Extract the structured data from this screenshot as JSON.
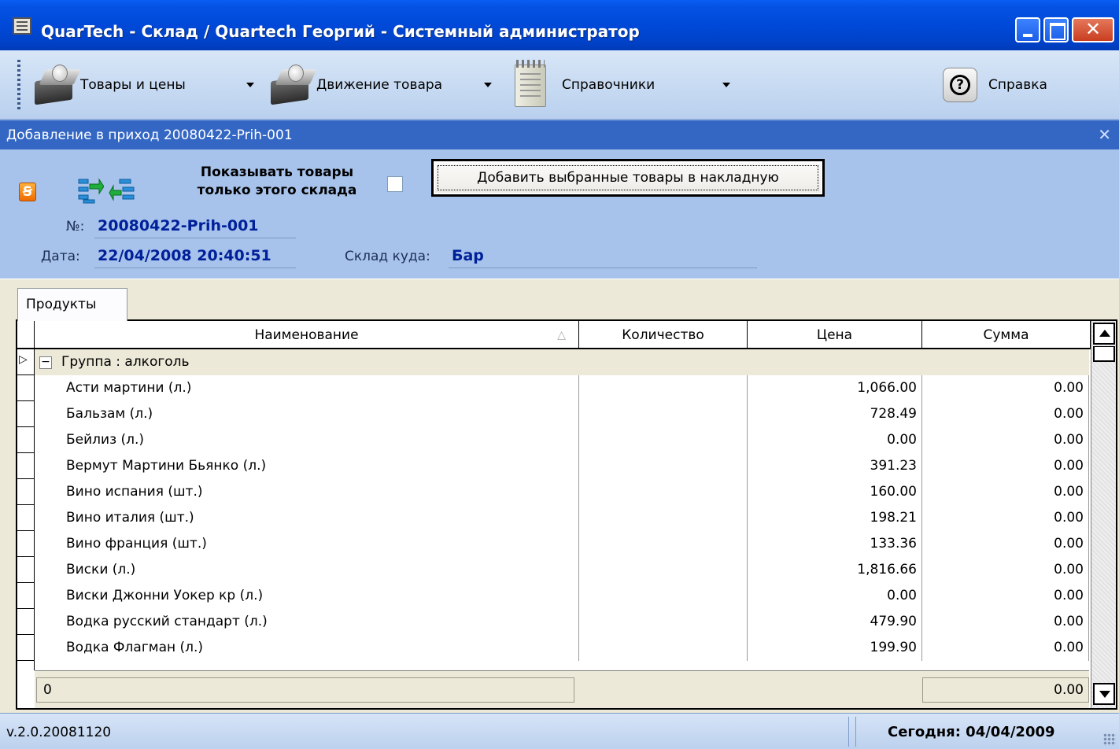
{
  "window": {
    "title": "QuarTech - Склад / Quartech Георгий - Системный администратор"
  },
  "toolbar": {
    "items": [
      {
        "label": "Товары и цены",
        "icon": "box-icon"
      },
      {
        "label": "Движение товара",
        "icon": "box-icon"
      },
      {
        "label": "Справочники",
        "icon": "notebook-icon"
      },
      {
        "label": "Справка",
        "icon": "help-icon"
      }
    ]
  },
  "document": {
    "title": "Добавление в приход 20080422-Prih-001",
    "show_only_label_1": "Показывать товары",
    "show_only_label_2": "только этого склада",
    "show_only_checked": false,
    "add_button_label": "Добавить выбранные товары в накладную",
    "number_label": "№:",
    "number_value": "20080422-Prih-001",
    "date_label": "Дата:",
    "date_value": "22/04/2008 20:40:51",
    "warehouse_label": "Склад куда:",
    "warehouse_value": "Бар"
  },
  "tabs": [
    {
      "label": "Продукты"
    }
  ],
  "grid": {
    "columns": [
      "Наименование",
      "Количество",
      "Цена",
      "Сумма"
    ],
    "group_label": "Группа : алкоголь",
    "group_expander": "−",
    "rows": [
      {
        "name": "Асти мартини (л.)",
        "qty": "",
        "price": "1,066.00",
        "sum": "0.00"
      },
      {
        "name": "Бальзам (л.)",
        "qty": "",
        "price": "728.49",
        "sum": "0.00"
      },
      {
        "name": "Бейлиз (л.)",
        "qty": "",
        "price": "0.00",
        "sum": "0.00"
      },
      {
        "name": "Вермут Мартини Бьянко (л.)",
        "qty": "",
        "price": "391.23",
        "sum": "0.00"
      },
      {
        "name": "Вино испания (шт.)",
        "qty": "",
        "price": "160.00",
        "sum": "0.00"
      },
      {
        "name": "Вино италия (шт.)",
        "qty": "",
        "price": "198.21",
        "sum": "0.00"
      },
      {
        "name": "Вино франция (шт.)",
        "qty": "",
        "price": "133.36",
        "sum": "0.00"
      },
      {
        "name": "Виски (л.)",
        "qty": "",
        "price": "1,816.66",
        "sum": "0.00"
      },
      {
        "name": "Виски Джонни Уокер кр (л.)",
        "qty": "",
        "price": "0.00",
        "sum": "0.00"
      },
      {
        "name": "Водка русский стандарт (л.)",
        "qty": "",
        "price": "479.90",
        "sum": "0.00"
      },
      {
        "name": "Водка Флагман (л.)",
        "qty": "",
        "price": "199.90",
        "sum": "0.00"
      }
    ],
    "footer_count": "0",
    "footer_sum": "0.00"
  },
  "status": {
    "version": "v.2.0.20081120",
    "today": "Сегодня: 04/04/2009"
  },
  "colors": {
    "title_bar": "#0049d8",
    "doc_bar": "#3467c4",
    "panel": "#a7c3eb",
    "value_text": "#00209a"
  }
}
